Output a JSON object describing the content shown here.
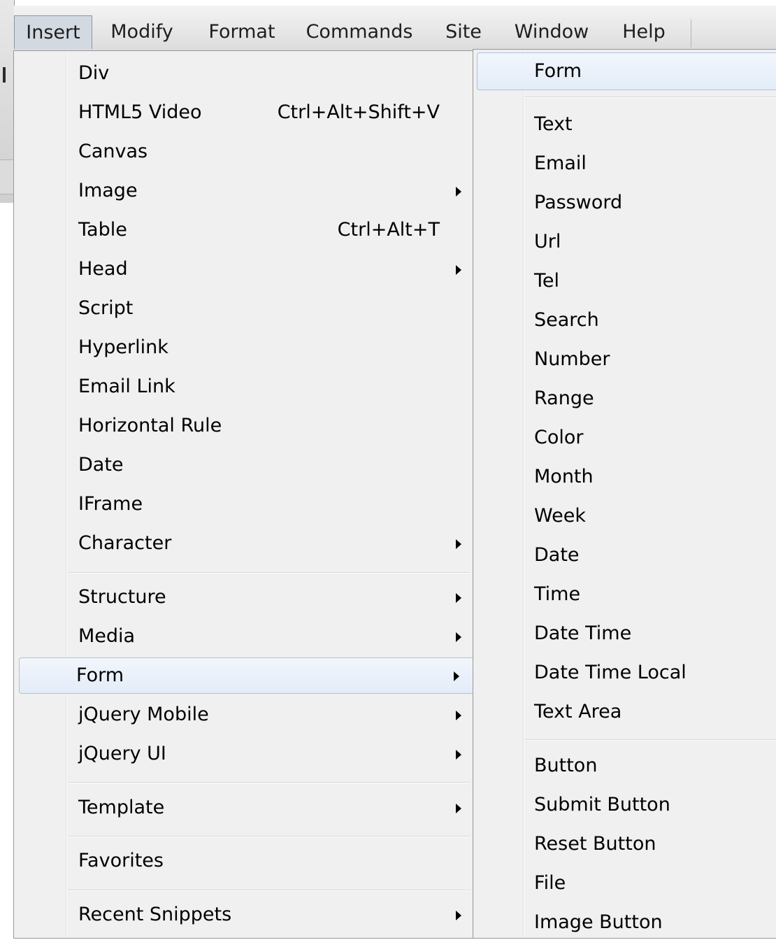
{
  "menubar": {
    "items": [
      {
        "label": "Insert",
        "active": true
      },
      {
        "label": "Modify"
      },
      {
        "label": "Format"
      },
      {
        "label": "Commands"
      },
      {
        "label": "Site"
      },
      {
        "label": "Window"
      },
      {
        "label": "Help"
      }
    ]
  },
  "insert_menu": {
    "items": [
      {
        "label": "Div"
      },
      {
        "label": "HTML5 Video",
        "shortcut": "Ctrl+Alt+Shift+V"
      },
      {
        "label": "Canvas"
      },
      {
        "label": "Image",
        "submenu": true
      },
      {
        "label": "Table",
        "shortcut": "Ctrl+Alt+T"
      },
      {
        "label": "Head",
        "submenu": true
      },
      {
        "label": "Script"
      },
      {
        "label": "Hyperlink"
      },
      {
        "label": "Email Link"
      },
      {
        "label": "Horizontal Rule"
      },
      {
        "label": "Date"
      },
      {
        "label": "IFrame"
      },
      {
        "label": "Character",
        "submenu": true
      },
      {
        "label": "Structure",
        "submenu": true
      },
      {
        "label": "Media",
        "submenu": true
      },
      {
        "label": "Form",
        "submenu": true,
        "highlighted": true
      },
      {
        "label": "jQuery Mobile",
        "submenu": true
      },
      {
        "label": "jQuery UI",
        "submenu": true
      },
      {
        "label": "Template",
        "submenu": true
      },
      {
        "label": "Favorites"
      },
      {
        "label": "Recent Snippets",
        "submenu": true
      }
    ]
  },
  "form_submenu": {
    "items": [
      {
        "label": "Form",
        "highlighted": true
      },
      {
        "label": "Text"
      },
      {
        "label": "Email"
      },
      {
        "label": "Password"
      },
      {
        "label": "Url"
      },
      {
        "label": "Tel"
      },
      {
        "label": "Search"
      },
      {
        "label": "Number"
      },
      {
        "label": "Range"
      },
      {
        "label": "Color"
      },
      {
        "label": "Month"
      },
      {
        "label": "Week"
      },
      {
        "label": "Date"
      },
      {
        "label": "Time"
      },
      {
        "label": "Date Time"
      },
      {
        "label": "Date Time Local"
      },
      {
        "label": "Text Area"
      },
      {
        "label": "Button"
      },
      {
        "label": "Submit Button"
      },
      {
        "label": "Reset Button"
      },
      {
        "label": "File"
      },
      {
        "label": "Image Button"
      }
    ]
  },
  "colors": {
    "menu_bg": "#f0f0f0",
    "highlight_bg": "#e3ecf8",
    "highlight_border": "#a9c2e3",
    "active_menubar_bg": "#d3d9e1"
  }
}
